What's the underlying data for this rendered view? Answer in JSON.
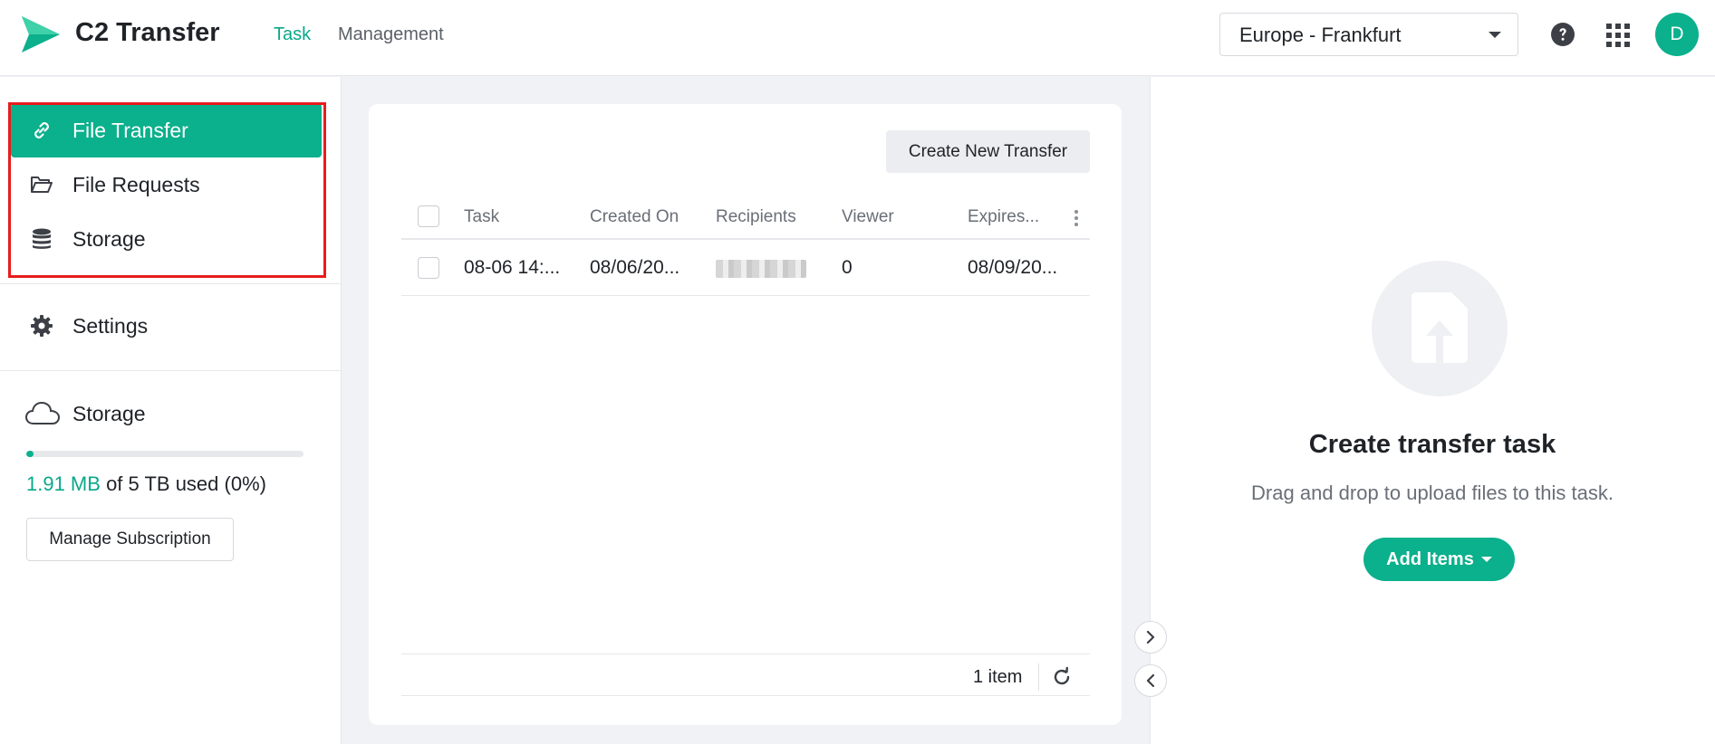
{
  "header": {
    "app_title": "C2 Transfer",
    "tabs": [
      {
        "label": "Task",
        "active": true
      },
      {
        "label": "Management",
        "active": false
      }
    ],
    "region": "Europe - Frankfurt",
    "avatar_initial": "D"
  },
  "sidebar": {
    "items": [
      {
        "label": "File Transfer",
        "icon": "link-icon",
        "active": true
      },
      {
        "label": "File Requests",
        "icon": "folder-open-icon",
        "active": false
      },
      {
        "label": "Storage",
        "icon": "database-icon",
        "active": false
      }
    ],
    "settings_label": "Settings",
    "storage": {
      "title": "Storage",
      "used": "1.91 MB",
      "rest": "of 5 TB used (0%)",
      "usage_fraction": 0.01,
      "manage_label": "Manage Subscription"
    }
  },
  "main": {
    "create_label": "Create New Transfer",
    "columns": [
      "Task",
      "Created On",
      "Recipients",
      "Viewer",
      "Expires..."
    ],
    "rows": [
      {
        "task": "08-06 14:...",
        "created_on": "08/06/20...",
        "recipients": "",
        "viewer": "0",
        "expires": "08/09/20..."
      }
    ],
    "item_count": "1 item"
  },
  "right_panel": {
    "title": "Create transfer task",
    "description": "Drag and drop to upload files to this task.",
    "add_label": "Add Items"
  },
  "colors": {
    "accent": "#0bb08c",
    "highlight_border": "#e81c1c"
  }
}
